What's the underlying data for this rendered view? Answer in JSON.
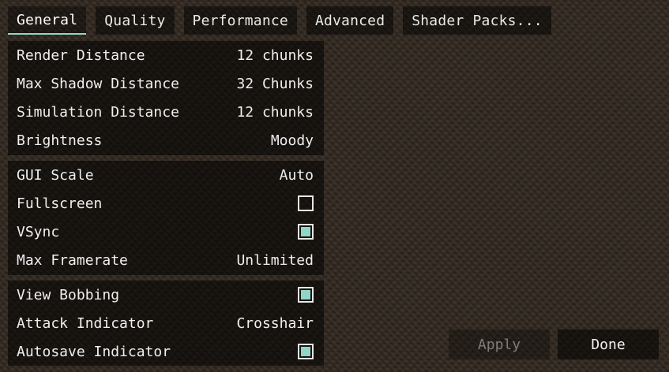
{
  "tabs": [
    {
      "label": "General",
      "active": true
    },
    {
      "label": "Quality",
      "active": false
    },
    {
      "label": "Performance",
      "active": false
    },
    {
      "label": "Advanced",
      "active": false
    },
    {
      "label": "Shader Packs...",
      "active": false
    }
  ],
  "groups": [
    {
      "rows": [
        {
          "label": "Render Distance",
          "value": "12 chunks"
        },
        {
          "label": "Max Shadow Distance",
          "value": "32 Chunks"
        },
        {
          "label": "Simulation Distance",
          "value": "12 chunks"
        },
        {
          "label": "Brightness",
          "value": "Moody"
        }
      ]
    },
    {
      "rows": [
        {
          "label": "GUI Scale",
          "value": "Auto"
        },
        {
          "label": "Fullscreen",
          "checked": false
        },
        {
          "label": "VSync",
          "checked": true
        },
        {
          "label": "Max Framerate",
          "value": "Unlimited"
        }
      ]
    },
    {
      "rows": [
        {
          "label": "View Bobbing",
          "checked": true
        },
        {
          "label": "Attack Indicator",
          "value": "Crosshair"
        },
        {
          "label": "Autosave Indicator",
          "checked": true
        }
      ]
    }
  ],
  "buttons": {
    "apply_label": "Apply",
    "apply_enabled": false,
    "done_label": "Done"
  },
  "colors": {
    "accent": "#8fd6c6",
    "background": "#2f261d",
    "disabled_text": "#7d7d7d"
  }
}
